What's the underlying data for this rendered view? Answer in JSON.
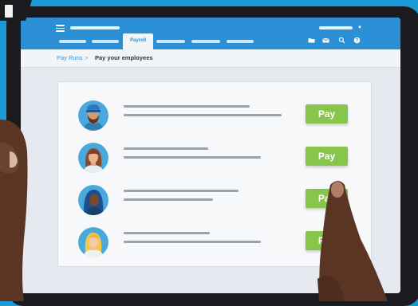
{
  "app": {
    "active_tab_label": "Payroll"
  },
  "breadcrumb": {
    "parent_label": "Pay Runs",
    "separator": ">",
    "current_label": "Pay your employees"
  },
  "employees": [
    {
      "avatar_icon": "man-with-beard-avatar-icon",
      "action_label": "Pay"
    },
    {
      "avatar_icon": "woman-with-brown-hair-avatar-icon",
      "action_label": "Pay"
    },
    {
      "avatar_icon": "woman-in-hijab-avatar-icon",
      "action_label": "Pay"
    },
    {
      "avatar_icon": "woman-with-blonde-hair-avatar-icon",
      "action_label": "Pay"
    }
  ],
  "toolbar_icons": [
    "folder-icon",
    "mail-icon",
    "search-icon",
    "help-icon"
  ],
  "colors": {
    "topbar": "#2a8fd4",
    "pay_button": "#86c64a",
    "background": "#1a9ad6"
  }
}
